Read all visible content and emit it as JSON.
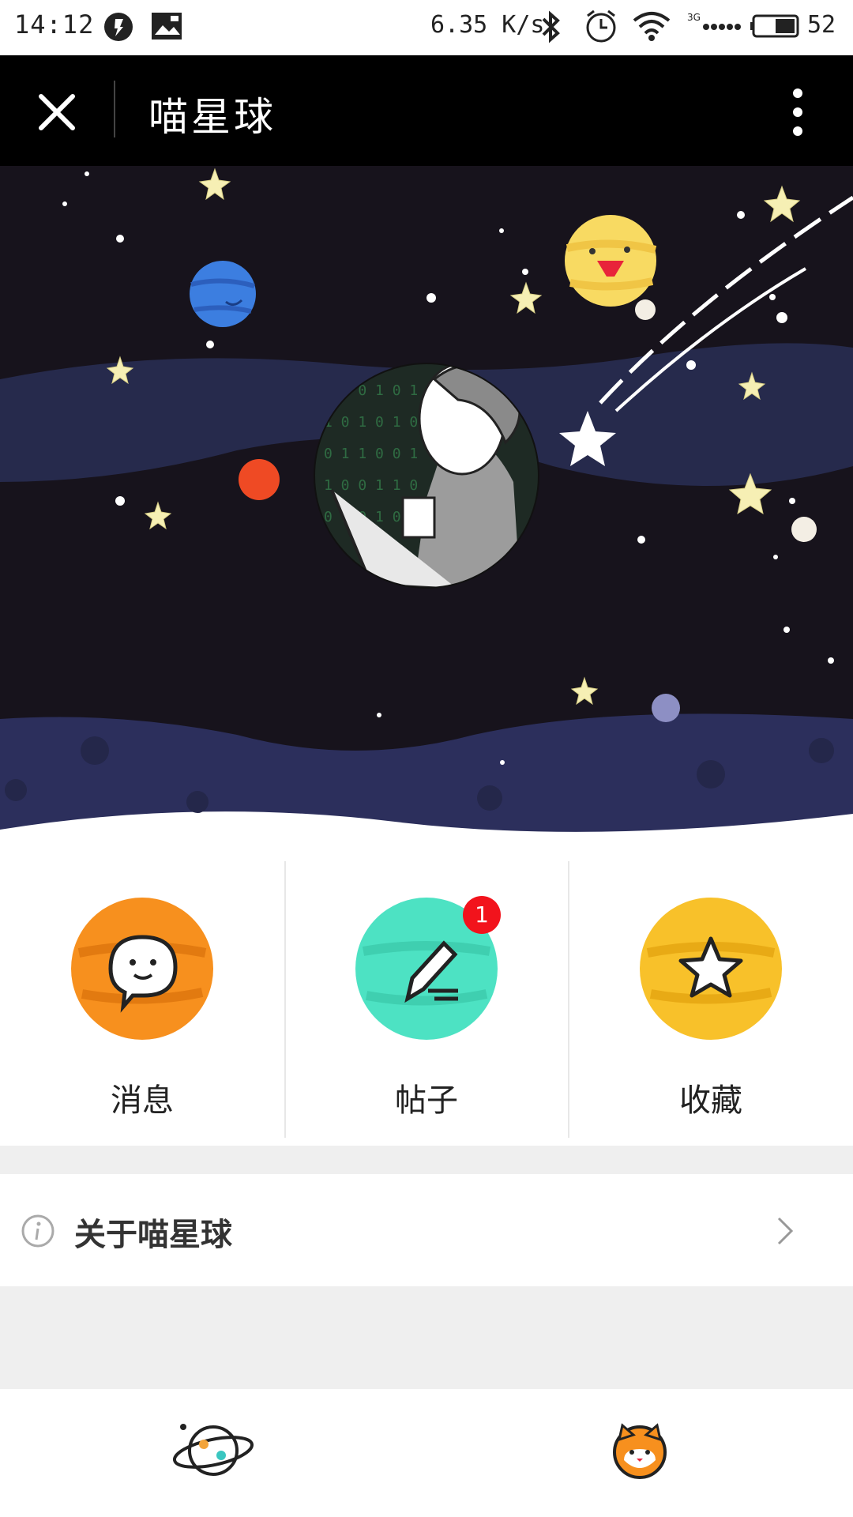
{
  "status_bar": {
    "time": "14:12",
    "net_speed": "6.35 K/s",
    "network": "3G",
    "battery": "52"
  },
  "title_bar": {
    "title": "喵星球",
    "close_icon": "close-icon",
    "more_icon": "more-vertical-icon"
  },
  "hero": {
    "background_color": "#17131c",
    "wave_color": "#2c2f5c"
  },
  "actions": [
    {
      "label": "消息",
      "icon": "chat-bubble-icon",
      "color": "#f7901e"
    },
    {
      "label": "帖子",
      "icon": "pencil-icon",
      "color": "#4de2c3",
      "badge": "1"
    },
    {
      "label": "收藏",
      "icon": "star-icon",
      "color": "#f8c12a"
    }
  ],
  "about": {
    "label": "关于喵星球",
    "icon": "info-icon"
  },
  "bottom_nav": [
    {
      "icon": "planet-icon"
    },
    {
      "icon": "cat-avatar-icon"
    }
  ]
}
